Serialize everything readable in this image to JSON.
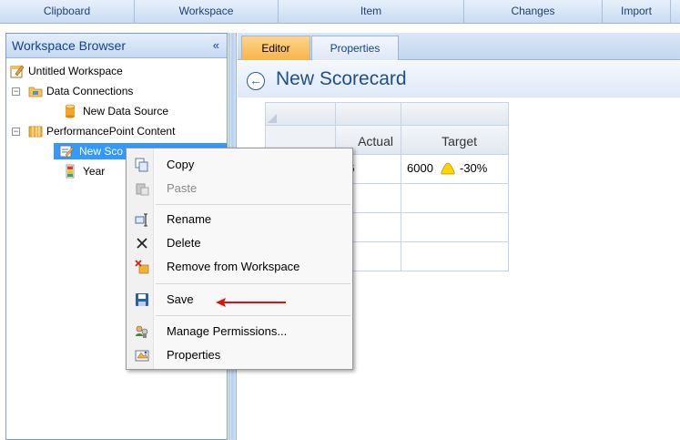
{
  "ribbon": {
    "groups": [
      "Clipboard",
      "Workspace",
      "Item",
      "Changes",
      "Import"
    ]
  },
  "workspace_browser": {
    "title": "Workspace Browser",
    "collapse_glyph": "«",
    "tree": [
      {
        "label": "Untitled Workspace",
        "icon": "workspace-icon"
      },
      {
        "label": "Data Connections",
        "icon": "data-connections-icon",
        "expanded": true
      },
      {
        "label": "New Data Source",
        "icon": "data-source-icon"
      },
      {
        "label": "PerformancePoint Content",
        "icon": "performancepoint-content-icon",
        "expanded": true
      },
      {
        "label": "New Scorecard",
        "icon": "scorecard-icon",
        "selected": true,
        "visible_text": "New Sco"
      },
      {
        "label": "Year",
        "icon": "kpi-icon"
      }
    ]
  },
  "editor": {
    "tabs": [
      {
        "label": "Editor",
        "active": true
      },
      {
        "label": "Properties",
        "active": false
      }
    ],
    "title": "New Scorecard",
    "back_glyph": "←"
  },
  "scorecard_grid": {
    "columns": [
      "Actual",
      "Target"
    ],
    "rows": [
      {
        "actual": "76",
        "target": "6000",
        "indicator": "yellow-triangle-indicator",
        "variance": "-30%"
      },
      {
        "actual": "",
        "target": "",
        "indicator": "",
        "variance": ""
      },
      {
        "actual": "",
        "target": "",
        "indicator": "",
        "variance": ""
      },
      {
        "actual": "",
        "target": "",
        "indicator": "",
        "variance": ""
      }
    ],
    "indicator_color": "#ffd400"
  },
  "context_menu": {
    "items": [
      {
        "label": "Copy",
        "icon": "copy-icon",
        "enabled": true
      },
      {
        "label": "Paste",
        "icon": "paste-icon",
        "enabled": false
      },
      {
        "label": "Rename",
        "icon": "rename-icon",
        "enabled": true
      },
      {
        "label": "Delete",
        "icon": "delete-icon",
        "enabled": true
      },
      {
        "label": "Remove from Workspace",
        "icon": "remove-from-workspace-icon",
        "enabled": true
      },
      {
        "label": "Save",
        "icon": "save-icon",
        "enabled": true
      },
      {
        "label": "Manage Permissions...",
        "icon": "manage-permissions-icon",
        "enabled": true
      },
      {
        "label": "Properties",
        "icon": "properties-icon",
        "enabled": true
      }
    ],
    "annotation_arrow_color": "#e01010"
  },
  "colors": {
    "accent": "#1f4e8c",
    "selection": "#3399ff",
    "active_tab": "#f7b44a"
  }
}
